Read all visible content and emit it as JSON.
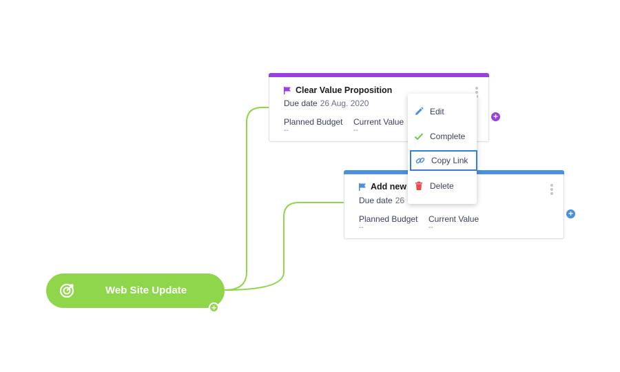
{
  "root": {
    "label": "Web Site Update",
    "color": "#8fd64b",
    "icon": "target-icon"
  },
  "card1": {
    "title": "Clear Value Proposition",
    "accent": "#9b3fe0",
    "due_label": "Due date",
    "due_value": "26 Aug. 2020",
    "planned_label": "Planned Budget",
    "planned_value": "--",
    "current_label": "Current Value",
    "current_value": "--"
  },
  "card2": {
    "title": "Add new",
    "accent": "#4a8fe0",
    "due_label": "Due date",
    "due_value": "26",
    "planned_label": "Planned Budget",
    "planned_value": "--",
    "current_label": "Current Value",
    "current_value": "--"
  },
  "context_menu": {
    "items": [
      {
        "label": "Edit",
        "icon": "pencil-icon"
      },
      {
        "label": "Complete",
        "icon": "check-icon"
      },
      {
        "label": "Copy Link",
        "icon": "link-icon",
        "selected": true
      },
      {
        "label": "Delete",
        "icon": "trash-icon"
      }
    ]
  }
}
